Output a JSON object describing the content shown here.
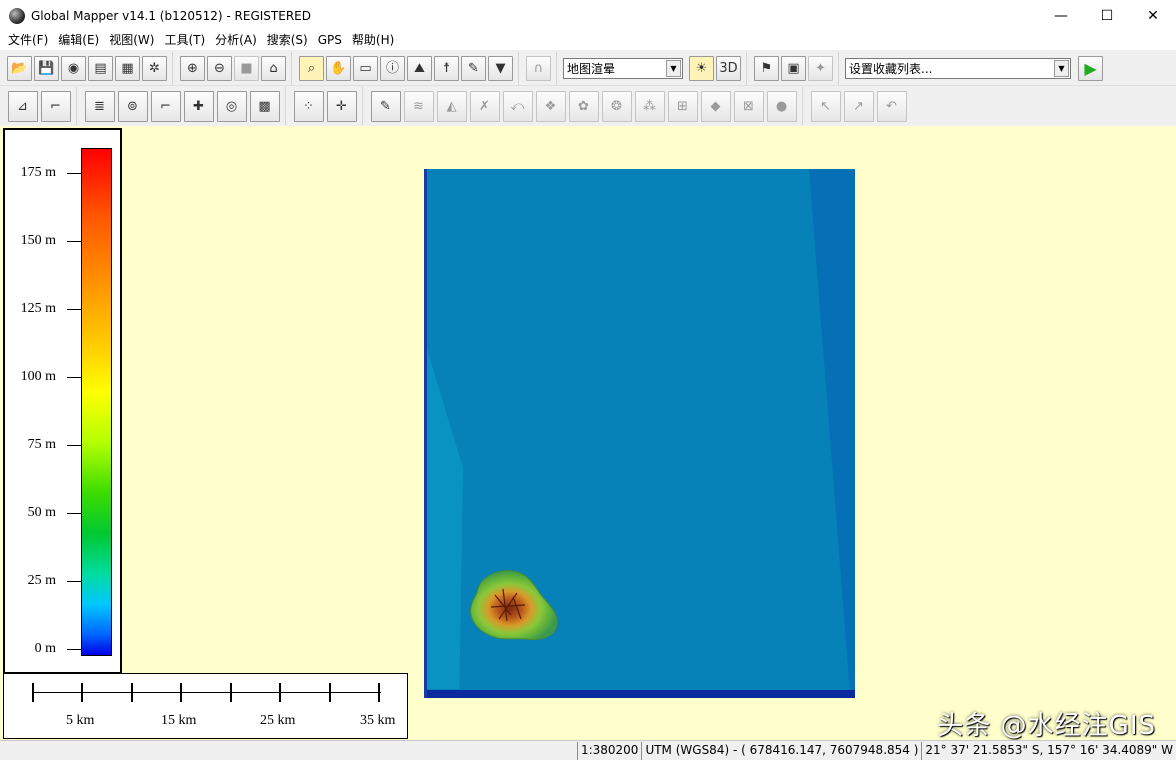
{
  "window": {
    "title": "Global Mapper v14.1 (b120512) - REGISTERED",
    "controls": [
      "—",
      "☐",
      "✕"
    ]
  },
  "menu": [
    "文件(F)",
    "编辑(E)",
    "视图(W)",
    "工具(T)",
    "分析(A)",
    "搜索(S)",
    "GPS",
    "帮助(H)"
  ],
  "toolbar": {
    "render_mode": "地图渲晕",
    "favorites": "设置收藏列表..."
  },
  "legend": {
    "labels": [
      "175 m",
      "150 m",
      "125 m",
      "100 m",
      "75 m",
      "50 m",
      "25 m",
      "0 m"
    ]
  },
  "scalebar": {
    "labels": [
      "5 km",
      "15 km",
      "25 km",
      "35 km"
    ]
  },
  "watermark": "头条 @水经注GIS",
  "status": {
    "scale": "1:380200",
    "projection": "UTM (WGS84) - ( 678416.147, 7607948.854 )",
    "latlon": "21° 37' 21.5853\" S, 157° 16' 34.4089\" W"
  },
  "colors": {
    "map_background": "#ffffcc",
    "ocean": "#0682b9",
    "run_button": "#22aa22"
  },
  "icons": {
    "toolbar1": [
      "open-folder-icon",
      "save-icon",
      "globe-icon",
      "layer-control-icon",
      "overlay-icon",
      "config-icon",
      "zoom-in-icon",
      "zoom-out-icon",
      "full-view-icon",
      "home-icon",
      "zoom-tool-icon",
      "pan-hand-icon",
      "measure-icon",
      "info-icon",
      "path-profile-icon",
      "view-shed-icon",
      "digitizer-icon",
      "filter-icon",
      "tunnel-icon",
      "shader-icon",
      "3d-view-icon",
      "flag-icon",
      "export-icon",
      "gps-icon",
      "run-icon"
    ],
    "toolbar2": [
      "create-area-icon",
      "create-line-icon",
      "stack-icon",
      "spiral-icon",
      "edit-line-icon",
      "code-icon",
      "circles-icon",
      "grid-icon",
      "points-icon",
      "cross-icon",
      "pencil-icon",
      "edit-1-icon",
      "edit-2-icon",
      "edit-3-icon",
      "edit-4-icon",
      "edit-5-icon",
      "edit-6-icon",
      "edit-7-icon",
      "edit-8-icon",
      "edit-9-icon",
      "edit-10-icon",
      "edit-11-icon",
      "edit-12-icon",
      "arrow-1-icon",
      "arrow-2-icon",
      "undo-icon"
    ]
  }
}
